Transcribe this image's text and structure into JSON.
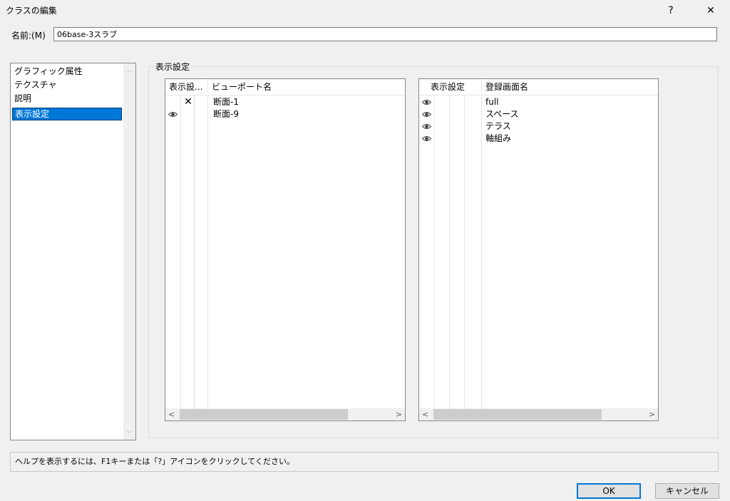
{
  "window": {
    "title": "クラスの編集",
    "help_glyph": "?",
    "close_glyph": "✕"
  },
  "name_field": {
    "label": "名前:(M)",
    "value": "06base-3スラブ"
  },
  "sidebar": {
    "items": [
      {
        "label": "グラフィック属性",
        "selected": false
      },
      {
        "label": "テクスチャ",
        "selected": false
      },
      {
        "label": "説明",
        "selected": false
      },
      {
        "label": "表示設定",
        "selected": true
      }
    ]
  },
  "group": {
    "label": "表示設定"
  },
  "viewport_list": {
    "headers": [
      "表示設...",
      "ビューポート名"
    ],
    "rows": [
      {
        "visibility": "hidden",
        "name": "断面-1"
      },
      {
        "visibility": "visible",
        "name": "断面-9"
      }
    ]
  },
  "saved_view_list": {
    "headers": [
      "表示設定",
      "登録画面名"
    ],
    "rows": [
      {
        "visibility": "visible",
        "name": "full"
      },
      {
        "visibility": "visible",
        "name": "スペース"
      },
      {
        "visibility": "visible",
        "name": "テラス"
      },
      {
        "visibility": "visible",
        "name": "軸組み"
      }
    ]
  },
  "scroll_glyphs": {
    "left": "<",
    "right": ">",
    "up": "︿",
    "down": "﹀"
  },
  "status_text": "ヘルプを表示するには、F1キーまたは「?」アイコンをクリックしてください。",
  "buttons": {
    "ok": "OK",
    "cancel": "キャンセル"
  },
  "colors": {
    "selection": "#0078d7",
    "background": "#f0f0f0"
  }
}
